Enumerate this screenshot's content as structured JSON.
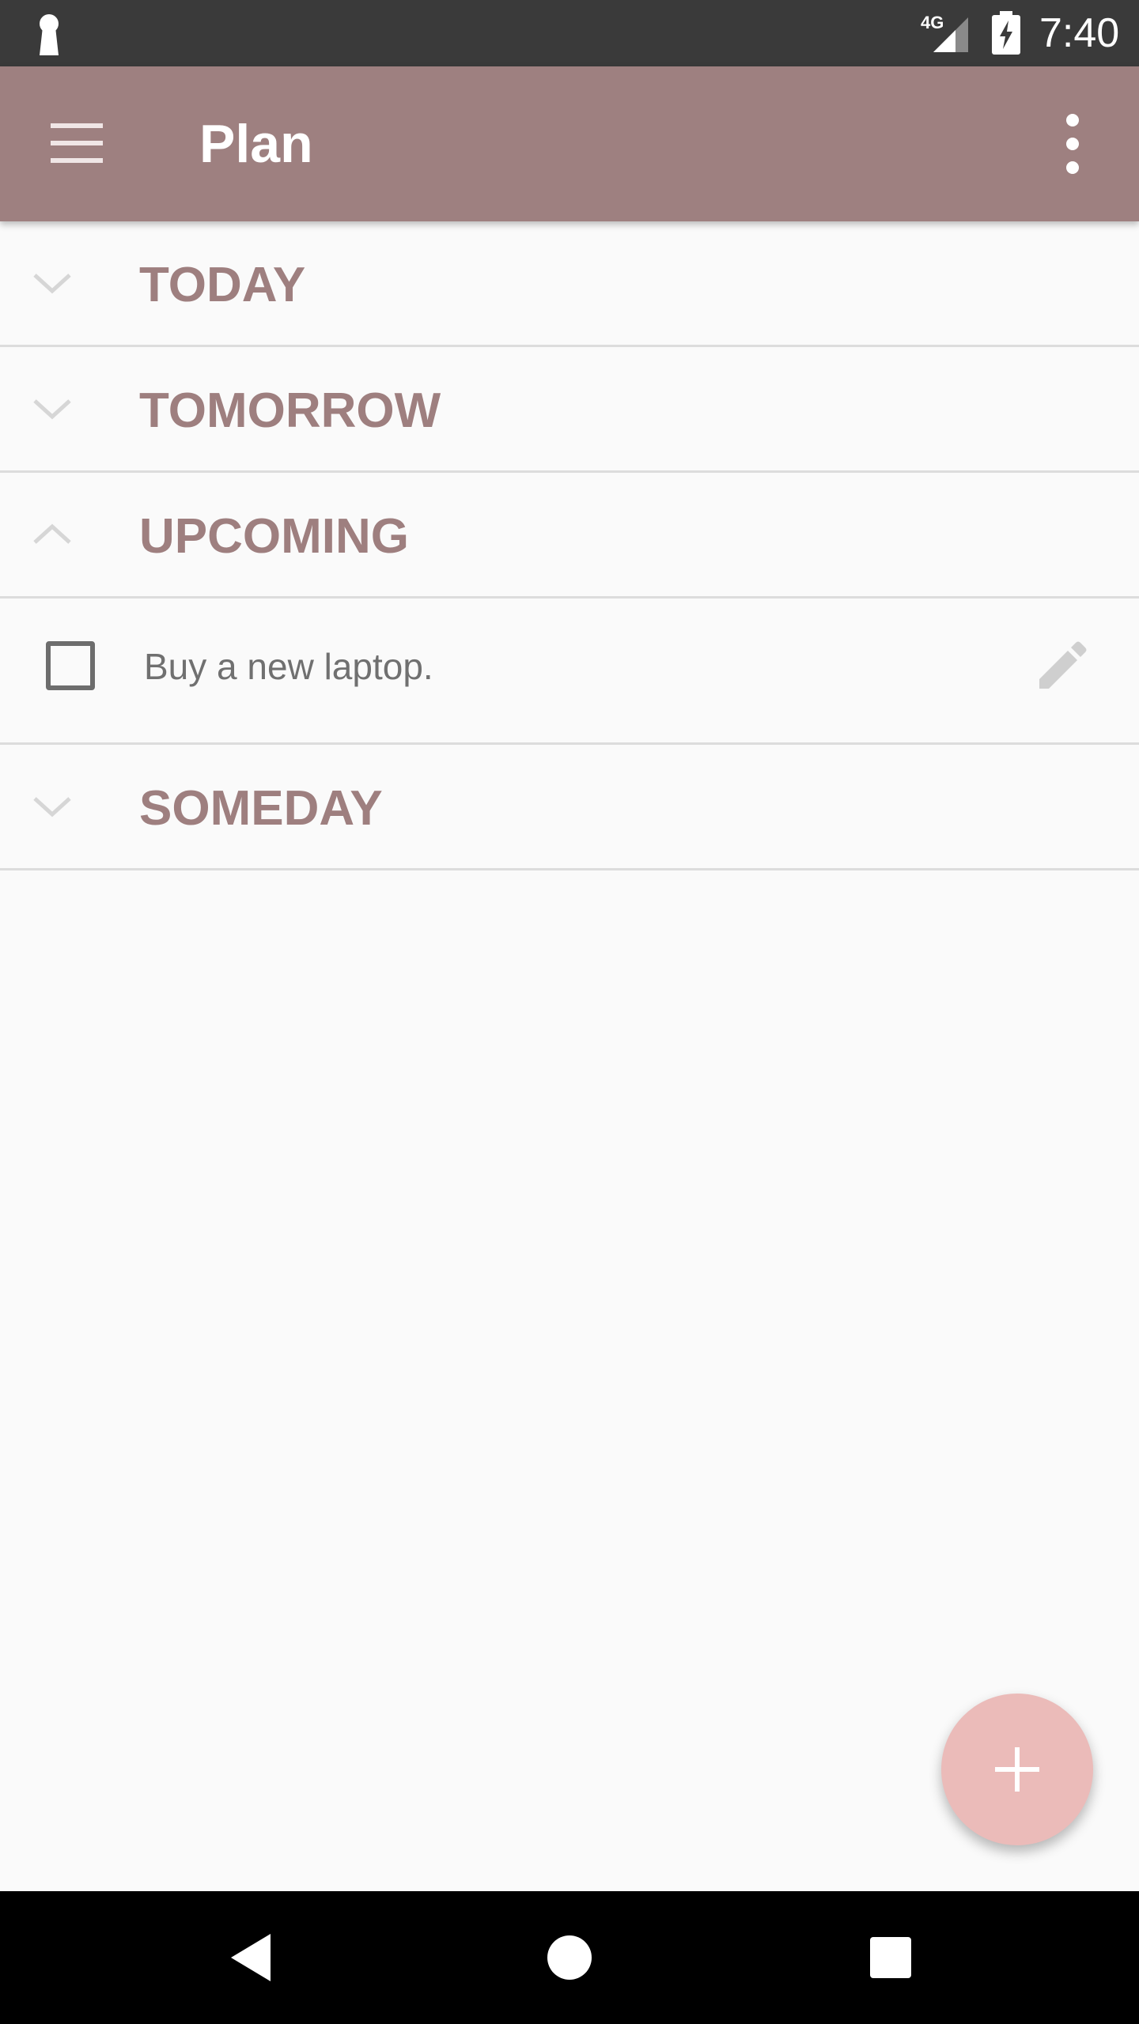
{
  "status_bar": {
    "network": "4G",
    "time": "7:40",
    "icons": [
      "keyhole-icon",
      "signal-icon",
      "battery-charging-icon"
    ]
  },
  "app_bar": {
    "title": "Plan",
    "menu_icon": "hamburger-menu-icon",
    "overflow_icon": "more-vert-icon"
  },
  "sections": [
    {
      "label": "TODAY",
      "expanded": false
    },
    {
      "label": "TOMORROW",
      "expanded": false
    },
    {
      "label": "UPCOMING",
      "expanded": true
    },
    {
      "label": "SOMEDAY",
      "expanded": false
    }
  ],
  "upcoming_tasks": [
    {
      "text": "Buy a new laptop.",
      "checked": false
    }
  ],
  "fab": {
    "icon": "plus-icon"
  },
  "nav_bar": {
    "icons": [
      "back-icon",
      "home-icon",
      "recents-icon"
    ]
  },
  "colors": {
    "app_bar": "#9e8080",
    "section_label": "#9e7f7f",
    "fab": "#ebbbb9",
    "status_bar": "#3a3a3a",
    "background": "#fafafa"
  }
}
